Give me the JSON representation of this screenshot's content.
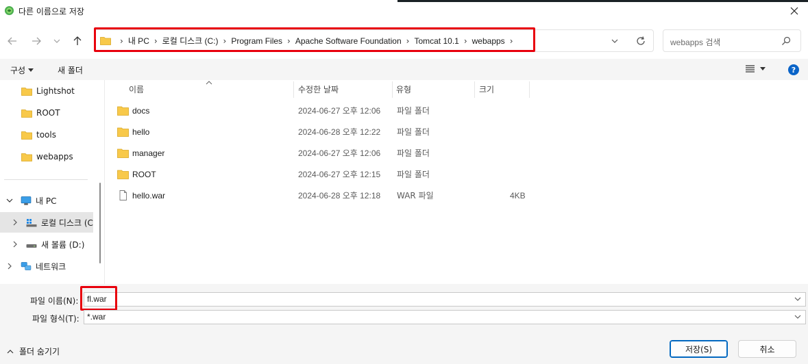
{
  "window": {
    "title": "다른 이름으로 저장",
    "close_glyph": "✕"
  },
  "nav": {
    "back_icon": "arrow-left-icon",
    "forward_icon": "arrow-right-icon",
    "recent_icon": "chevron-down-icon",
    "up_icon": "arrow-up-icon",
    "breadcrumbs": [
      "내 PC",
      "로컬 디스크 (C:)",
      "Program Files",
      "Apache Software Foundation",
      "Tomcat 10.1",
      "webapps"
    ],
    "search_placeholder": "webapps 검색"
  },
  "toolbar": {
    "organize_label": "구성",
    "new_folder_label": "새 폴더",
    "help_label": "?"
  },
  "sidebar": {
    "items": [
      {
        "label": "Lightshot",
        "kind": "folder"
      },
      {
        "label": "ROOT",
        "kind": "folder"
      },
      {
        "label": "tools",
        "kind": "folder"
      },
      {
        "label": "webapps",
        "kind": "folder"
      },
      {
        "label": "내 PC",
        "kind": "pc"
      },
      {
        "label": "로컬 디스크 (C",
        "kind": "drive-c"
      },
      {
        "label": "새 볼륨 (D:)",
        "kind": "drive"
      },
      {
        "label": "네트워크",
        "kind": "network"
      }
    ]
  },
  "filelist": {
    "columns": {
      "name": "이름",
      "modified": "수정한 날짜",
      "type": "유형",
      "size": "크기"
    },
    "rows": [
      {
        "name": "docs",
        "modified": "2024-06-27 오후 12:06",
        "type": "파일 폴더",
        "size": "",
        "kind": "folder"
      },
      {
        "name": "hello",
        "modified": "2024-06-28 오후 12:22",
        "type": "파일 폴더",
        "size": "",
        "kind": "folder"
      },
      {
        "name": "manager",
        "modified": "2024-06-27 오후 12:06",
        "type": "파일 폴더",
        "size": "",
        "kind": "folder"
      },
      {
        "name": "ROOT",
        "modified": "2024-06-27 오후 12:15",
        "type": "파일 폴더",
        "size": "",
        "kind": "folder"
      },
      {
        "name": "hello.war",
        "modified": "2024-06-28 오후 12:18",
        "type": "WAR 파일",
        "size": "4KB",
        "kind": "file"
      }
    ]
  },
  "form": {
    "filename_label": "파일 이름(N):",
    "filename_value": "fl.war",
    "filetype_label": "파일 형식(T):",
    "filetype_value": "*.war",
    "hide_folders_label": "폴더 숨기기",
    "save_label": "저장(S)",
    "cancel_label": "취소"
  },
  "colors": {
    "accent": "#0067c0",
    "highlight_red": "#e8000c",
    "folder_yellow": "#f8c94a"
  }
}
